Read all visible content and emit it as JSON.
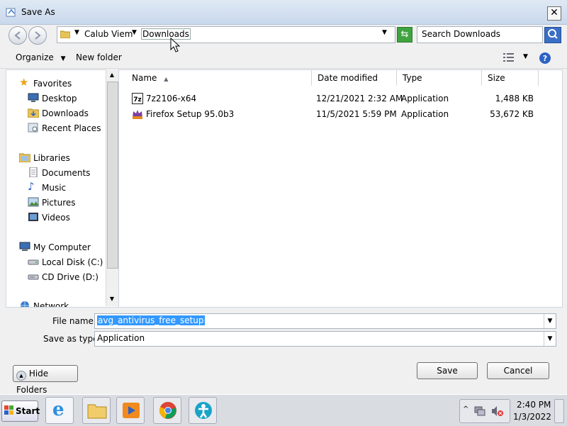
{
  "window": {
    "title": "Save As",
    "close_label": "✕"
  },
  "address": {
    "crumbs": [
      "Calub Viem",
      "Downloads"
    ],
    "search_placeholder": "Search Downloads"
  },
  "toolbar": {
    "organize": "Organize",
    "new_folder": "New folder"
  },
  "sidebar": {
    "favorites": {
      "label": "Favorites",
      "items": [
        "Desktop",
        "Downloads",
        "Recent Places"
      ]
    },
    "libraries": {
      "label": "Libraries",
      "items": [
        "Documents",
        "Music",
        "Pictures",
        "Videos"
      ]
    },
    "computer": {
      "label": "My Computer",
      "items": [
        "Local Disk (C:)",
        "CD Drive (D:)"
      ]
    },
    "network": {
      "label": "Network"
    }
  },
  "filelist": {
    "columns": [
      "Name",
      "Date modified",
      "Type",
      "Size"
    ],
    "rows": [
      {
        "name": "7z2106-x64",
        "date": "12/21/2021 2:32 AM",
        "type": "Application",
        "size": "1,488 KB"
      },
      {
        "name": "Firefox Setup 95.0b3",
        "date": "11/5/2021 5:59 PM",
        "type": "Application",
        "size": "53,672 KB"
      }
    ]
  },
  "form": {
    "filename_label": "File name:",
    "filename_value": "avg_antivirus_free_setup",
    "savetype_label": "Save as type:",
    "savetype_value": "Application"
  },
  "buttons": {
    "hide_folders": "Hide Folders",
    "save": "Save",
    "cancel": "Cancel"
  },
  "taskbar": {
    "start": "Start",
    "time": "2:40 PM",
    "date": "1/3/2022"
  }
}
